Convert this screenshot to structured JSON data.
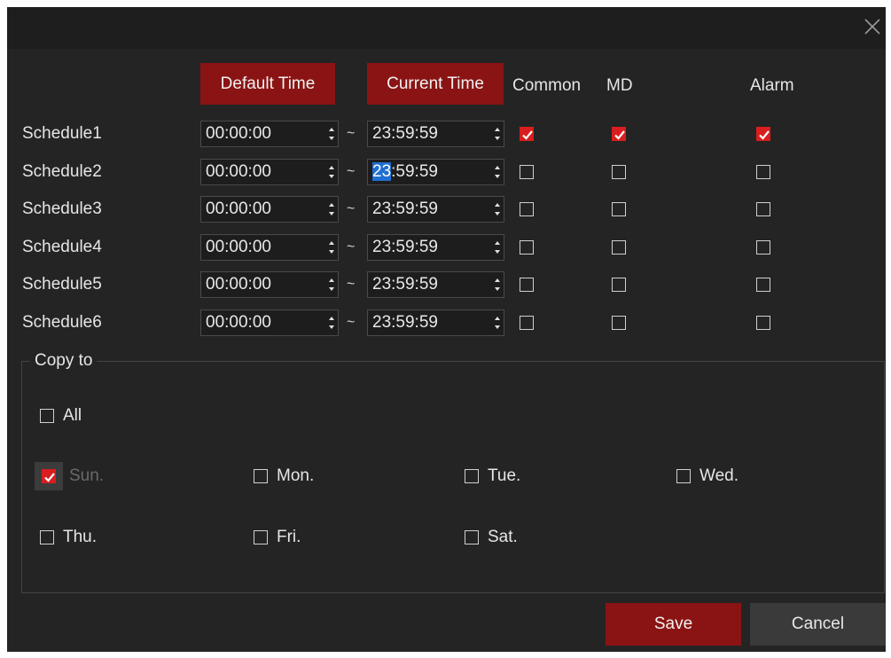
{
  "buttons": {
    "default_time": "Default Time",
    "current_time": "Current Time",
    "save": "Save",
    "cancel": "Cancel"
  },
  "headers": {
    "common": "Common",
    "md": "MD",
    "alarm": "Alarm"
  },
  "separator": "~",
  "schedules": [
    {
      "label": "Schedule1",
      "start": "00:00:00",
      "end": "23:59:59",
      "common": true,
      "md": true,
      "alarm": true
    },
    {
      "label": "Schedule2",
      "start": "00:00:00",
      "end": "23:59:59",
      "end_selected_part": "23",
      "end_rest": ":59:59",
      "common": false,
      "md": false,
      "alarm": false
    },
    {
      "label": "Schedule3",
      "start": "00:00:00",
      "end": "23:59:59",
      "common": false,
      "md": false,
      "alarm": false
    },
    {
      "label": "Schedule4",
      "start": "00:00:00",
      "end": "23:59:59",
      "common": false,
      "md": false,
      "alarm": false
    },
    {
      "label": "Schedule5",
      "start": "00:00:00",
      "end": "23:59:59",
      "common": false,
      "md": false,
      "alarm": false
    },
    {
      "label": "Schedule6",
      "start": "00:00:00",
      "end": "23:59:59",
      "common": false,
      "md": false,
      "alarm": false
    }
  ],
  "copy_to": {
    "title": "Copy to",
    "all": "All",
    "days": {
      "sun": "Sun.",
      "mon": "Mon.",
      "tue": "Tue.",
      "wed": "Wed.",
      "thu": "Thu.",
      "fri": "Fri.",
      "sat": "Sat."
    },
    "checked": {
      "all": false,
      "sun": true,
      "mon": false,
      "tue": false,
      "wed": false,
      "thu": false,
      "fri": false,
      "sat": false
    }
  },
  "colors": {
    "dialog_bg": "#242424",
    "titlebar_bg": "#1e1e1e",
    "accent_red": "#8a1414",
    "checkbox_red": "#d81e1e",
    "selection_blue": "#1f6fd0"
  },
  "icons": [
    "close-icon",
    "spin-up-icon",
    "spin-down-icon",
    "checkmark-icon"
  ]
}
